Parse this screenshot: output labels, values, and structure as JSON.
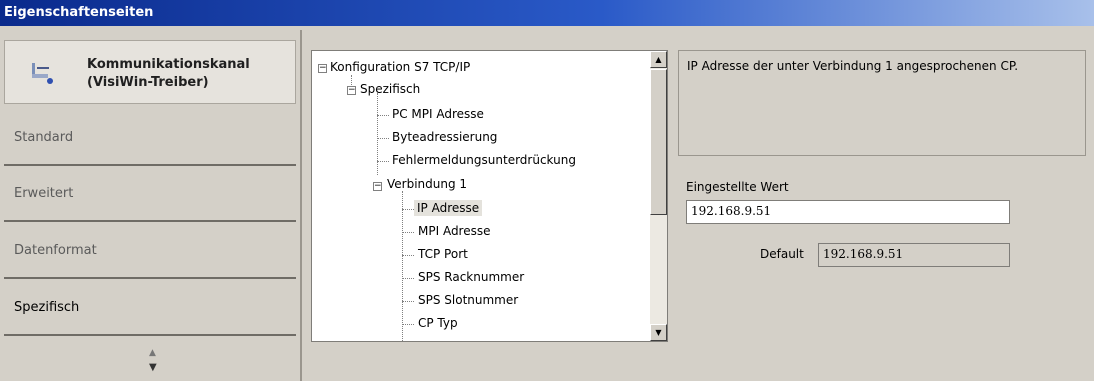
{
  "window": {
    "title": "Eigenschaftenseiten"
  },
  "nav": {
    "header_line1": "Kommunikationskanal",
    "header_line2": "(VisiWin-Treiber)",
    "items": [
      {
        "label": "Standard"
      },
      {
        "label": "Erweitert"
      },
      {
        "label": "Datenformat"
      },
      {
        "label": "Spezifisch"
      }
    ],
    "active": "Spezifisch"
  },
  "tree": {
    "nodes": [
      {
        "label": "Konfiguration S7 TCP/IP"
      },
      {
        "label": "Spezifisch"
      },
      {
        "label": "PC MPI Adresse"
      },
      {
        "label": "Byteadressierung"
      },
      {
        "label": "Fehlermeldungsunterdrückung"
      },
      {
        "label": "Verbindung 1"
      },
      {
        "label": "IP Adresse"
      },
      {
        "label": "MPI Adresse"
      },
      {
        "label": "TCP Port"
      },
      {
        "label": "SPS Racknummer"
      },
      {
        "label": "SPS Slotnummer"
      },
      {
        "label": "CP Typ"
      }
    ],
    "selected": "IP Adresse"
  },
  "description": "IP Adresse der unter Verbindung 1 angesprochenen CP.",
  "value_label": "Eingestellte Wert",
  "value": "192.168.9.51",
  "default_label": "Default",
  "default_value": "192.168.9.51",
  "colors": {
    "titlebar_start": "#0a2a8c",
    "titlebar_end": "#a8c0ea",
    "panel": "#d4d0c8"
  }
}
